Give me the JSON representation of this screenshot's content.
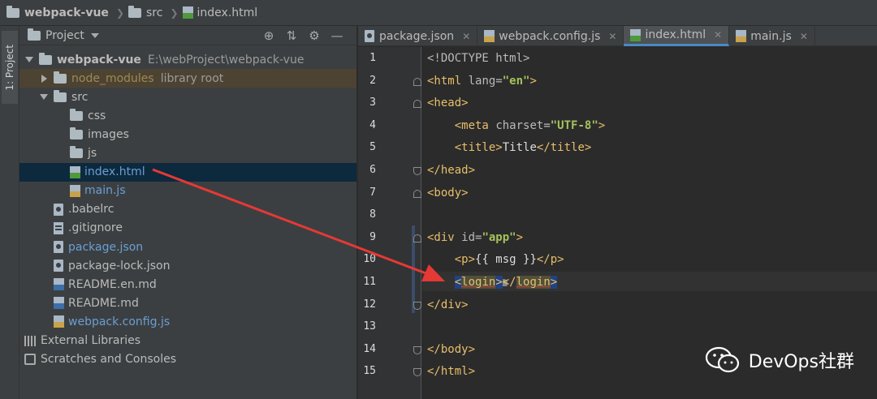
{
  "breadcrumb": {
    "project": "webpack-vue",
    "folder": "src",
    "file": "index.html"
  },
  "toolstrip": {
    "project_label": "1: Project"
  },
  "panel": {
    "title": "Project",
    "icons": [
      "crosshair-icon",
      "collapse-icon",
      "gear-icon",
      "minimize-icon"
    ]
  },
  "tree": [
    {
      "name": "webpack-vue",
      "hint": "E:\\webProject\\webpack-vue",
      "type": "folder",
      "expand": "open",
      "depth": 0,
      "style": "bold"
    },
    {
      "name": "node_modules",
      "hint": "library root",
      "type": "folder",
      "expand": "closed",
      "depth": 1,
      "style": "yellow",
      "row": "lib"
    },
    {
      "name": "src",
      "hint": "",
      "type": "folder",
      "expand": "open",
      "depth": 1,
      "style": ""
    },
    {
      "name": "css",
      "hint": "",
      "type": "folder",
      "expand": "",
      "depth": 2,
      "style": ""
    },
    {
      "name": "images",
      "hint": "",
      "type": "folder",
      "expand": "",
      "depth": 2,
      "style": ""
    },
    {
      "name": "js",
      "hint": "",
      "type": "folder",
      "expand": "",
      "depth": 2,
      "style": ""
    },
    {
      "name": "index.html",
      "hint": "",
      "type": "html",
      "expand": "",
      "depth": 2,
      "style": "blue",
      "row": "sel"
    },
    {
      "name": "main.js",
      "hint": "",
      "type": "js",
      "expand": "",
      "depth": 2,
      "style": "blue"
    },
    {
      "name": ".babelrc",
      "hint": "",
      "type": "cfg",
      "expand": "",
      "depth": 1,
      "style": ""
    },
    {
      "name": ".gitignore",
      "hint": "",
      "type": "txt",
      "expand": "",
      "depth": 1,
      "style": ""
    },
    {
      "name": "package.json",
      "hint": "",
      "type": "cfg",
      "expand": "",
      "depth": 1,
      "style": "blue"
    },
    {
      "name": "package-lock.json",
      "hint": "",
      "type": "cfg",
      "expand": "",
      "depth": 1,
      "style": ""
    },
    {
      "name": "README.en.md",
      "hint": "",
      "type": "md",
      "expand": "",
      "depth": 1,
      "style": ""
    },
    {
      "name": "README.md",
      "hint": "",
      "type": "md",
      "expand": "",
      "depth": 1,
      "style": ""
    },
    {
      "name": "webpack.config.js",
      "hint": "",
      "type": "js",
      "expand": "",
      "depth": 1,
      "style": "blue"
    },
    {
      "name": "External Libraries",
      "hint": "",
      "type": "lib",
      "expand": "",
      "depth": 0,
      "style": ""
    },
    {
      "name": "Scratches and Consoles",
      "hint": "",
      "type": "scratch",
      "expand": "",
      "depth": 0,
      "style": ""
    }
  ],
  "tabs": [
    {
      "label": "package.json",
      "type": "cfg",
      "active": false
    },
    {
      "label": "webpack.config.js",
      "type": "js",
      "active": false
    },
    {
      "label": "index.html",
      "type": "html",
      "active": true
    },
    {
      "label": "main.js",
      "type": "js",
      "active": false
    }
  ],
  "editor": {
    "line_numbers": [
      "1",
      "2",
      "3",
      "4",
      "5",
      "6",
      "7",
      "8",
      "9",
      "10",
      "11",
      "12",
      "13",
      "14",
      "15"
    ],
    "current_line": "11",
    "lines": [
      "<!DOCTYPE html>",
      "<html lang=\"en\">",
      "<head>",
      "    <meta charset=\"UTF-8\">",
      "    <title>Title</title>",
      "</head>",
      "<body>",
      "",
      "<div id=\"app\">",
      "    <p>{{ msg }}</p>",
      "    <login></login>",
      "</div>",
      "",
      "</body>",
      "</html>"
    ]
  },
  "watermark": {
    "text": "DevOps社群",
    "icon": "wechat-icon"
  },
  "colors": {
    "tag": "#e8bf6a",
    "string": "#a5c25c",
    "selection": "#214283",
    "arrow": "#e53935"
  }
}
